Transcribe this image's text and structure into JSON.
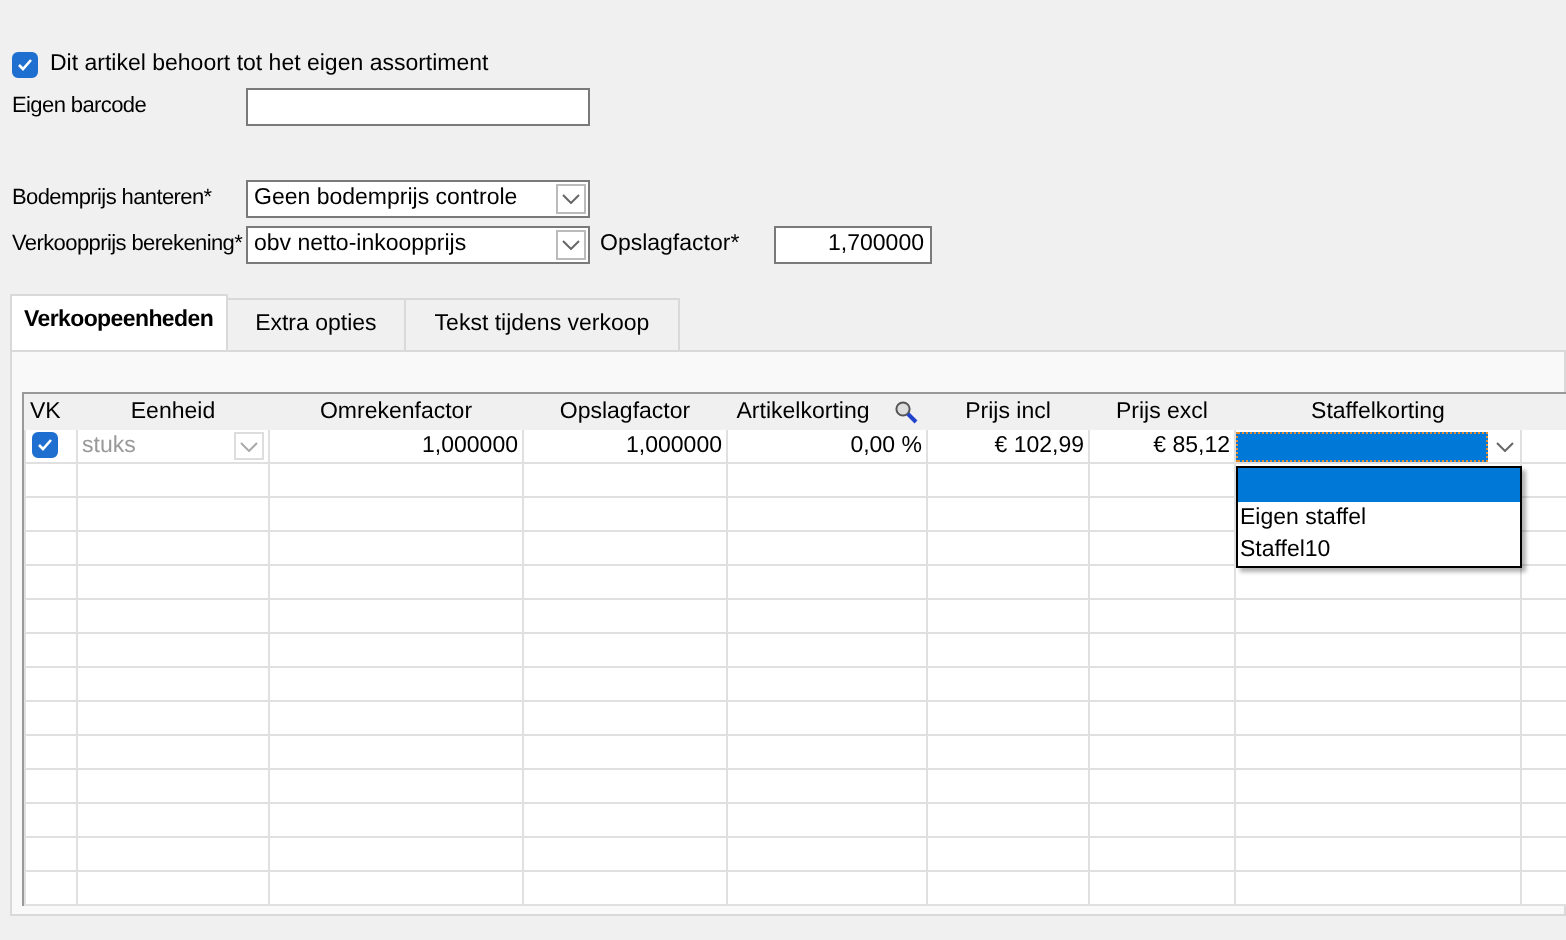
{
  "own_assortment": {
    "label": "Dit artikel behoort tot het eigen assortiment",
    "checked": true
  },
  "barcode": {
    "label": "Eigen barcode"
  },
  "floor_price": {
    "label": "Bodemprijs hanteren*",
    "value": "Geen bodemprijs controle"
  },
  "price_calc": {
    "label": "Verkoopprijs berekening*",
    "value": "obv netto-inkoopprijs"
  },
  "markup": {
    "label": "Opslagfactor*",
    "value": "1,700000"
  },
  "tabs": [
    {
      "label": "Verkoopeenheden",
      "selected": true
    },
    {
      "label": "Extra opties",
      "selected": false
    },
    {
      "label": "Tekst tijdens verkoop",
      "selected": false
    }
  ],
  "table": {
    "columns": [
      "VK",
      "Eenheid",
      "Omrekenfactor",
      "Opslagfactor",
      "Artikelkorting",
      "Prijs incl",
      "Prijs excl",
      "Staffelkorting"
    ],
    "rows": [
      {
        "vk": true,
        "unit": "stuks",
        "conversion": "1,000000",
        "markup": "1,000000",
        "discount": "0,00 %",
        "price_incl": "€ 102,99",
        "price_excl": "€ 85,12"
      }
    ],
    "dropdown": {
      "options": [
        {
          "selected": true
        },
        {
          "label": "Eigen staffel",
          "selected": false
        },
        {
          "label": "Staffel10",
          "selected": false
        }
      ]
    }
  }
}
